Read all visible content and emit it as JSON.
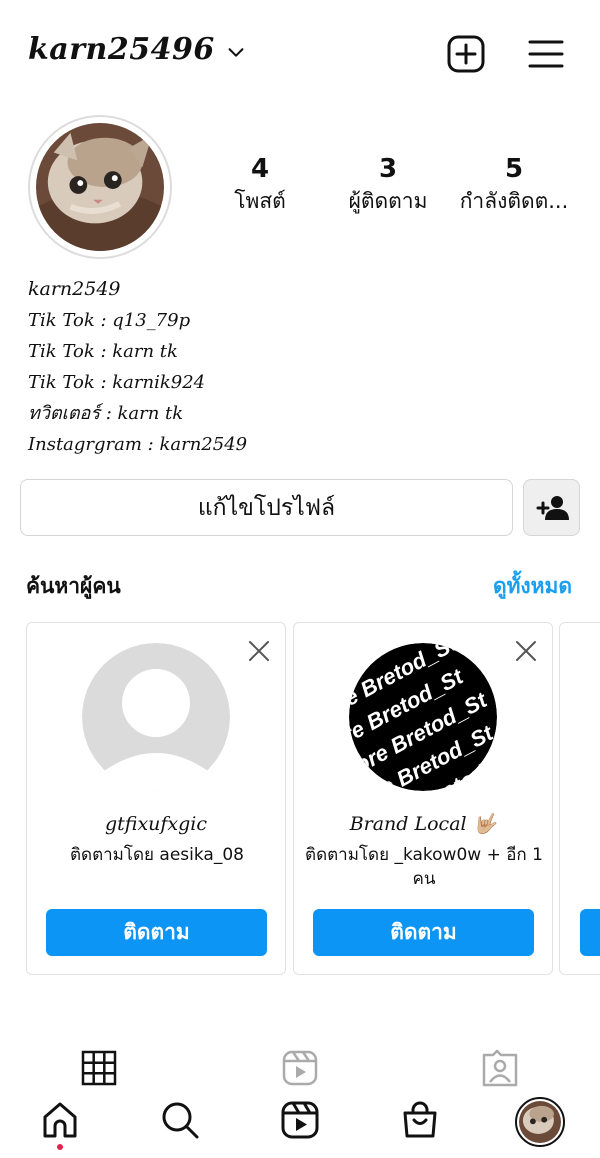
{
  "header": {
    "username": "karn25496",
    "icons": [
      "chevron-down-icon",
      "plus-square-icon",
      "menu-icon"
    ]
  },
  "profile": {
    "stats": [
      {
        "value": "4",
        "label": "โพสต์"
      },
      {
        "value": "3",
        "label": "ผู้ติดตาม"
      },
      {
        "value": "5",
        "label": "กำลังติดต..."
      }
    ]
  },
  "bio": {
    "name": "karn2549",
    "lines": [
      "Tik Tok : q13_79p",
      "Tik Tok : karn tk",
      "Tik Tok : karnik924",
      "ทวิตเตอร์ : karn tk",
      "Instagrgram : karn2549"
    ]
  },
  "actions": {
    "edit_profile": "แก้ไขโปรไฟล์",
    "add_user_icon": "add-user-icon"
  },
  "discover": {
    "title": "ค้นหาผู้คน",
    "see_all": "ดูทั้งหมด",
    "cards": [
      {
        "name": "gtfixufxgic",
        "sub": "ติดตามโดย aesika_08",
        "button": "ติดตาม"
      },
      {
        "name": "Brand Local 🤟🏼",
        "sub": "ติดตามโดย _kakow0w + อีก 1 คน",
        "button": "ติดตาม",
        "pattern_text": "Store Bretod_St"
      }
    ]
  },
  "tabs": [
    "grid-icon",
    "reels-icon",
    "tagged-icon"
  ],
  "bottom_nav": [
    "home-icon",
    "search-icon",
    "reels-icon",
    "shop-icon",
    "profile-avatar"
  ],
  "colors": {
    "accent": "#0c95f5",
    "link": "#1a9ff0",
    "notification": "#e5224b"
  }
}
